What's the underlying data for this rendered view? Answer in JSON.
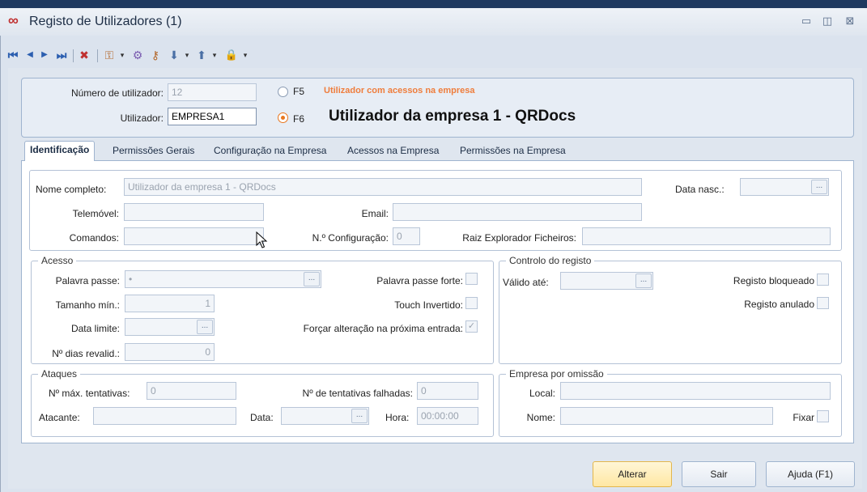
{
  "window": {
    "title": "Registo de Utilizadores (1)",
    "app_icon": "∞",
    "minimize_glyph": "▭",
    "restore_glyph": "◫",
    "close_glyph": "⊠"
  },
  "toolbar": {
    "first_glyph": "⏮",
    "prev_glyph": "◀",
    "next_glyph": "▶",
    "last_glyph": "⏭",
    "delete_glyph": "✖",
    "users_glyph": "⚿",
    "dropdown_glyph": "▾",
    "tools_glyph": "⚙",
    "key_glyph": "⚷",
    "import_glyph": "⬇",
    "export_glyph": "⬆",
    "lock_glyph": "🔒"
  },
  "header": {
    "numero_label": "Número de utilizador:",
    "numero_value": "12",
    "utilizador_label": "Utilizador:",
    "utilizador_value": "EMPRESA1",
    "f5_label": "F5",
    "f5_note": "Utilizador com acessos na empresa",
    "f6_label": "F6",
    "f6_heading": "Utilizador da empresa 1 - QRDocs",
    "f5_selected": false,
    "f6_selected": true,
    "note_color": "#ef7d3c",
    "radio_accent": "#e8761e"
  },
  "tabs": [
    {
      "label": "Identificação",
      "active": true
    },
    {
      "label": "Permissões Gerais",
      "active": false
    },
    {
      "label": "Configuração na Empresa",
      "active": false
    },
    {
      "label": "Acessos na Empresa",
      "active": false
    },
    {
      "label": "Permissões na Empresa",
      "active": false
    }
  ],
  "identificacao": {
    "nome_completo_label": "Nome completo:",
    "nome_completo_value": "Utilizador da empresa 1 - QRDocs",
    "data_nasc_label": "Data nasc.:",
    "data_nasc_value": "",
    "telemovel_label": "Telemóvel:",
    "telemovel_value": "",
    "email_label": "Email:",
    "email_value": "",
    "comandos_label": "Comandos:",
    "comandos_value": "",
    "n_config_label": "N.º Configuração:",
    "n_config_value": "0",
    "raiz_label": "Raiz Explorador Ficheiros:",
    "raiz_value": "",
    "ellipsis": "..."
  },
  "acesso": {
    "title": "Acesso",
    "palavra_passe_label": "Palavra passe:",
    "palavra_passe_value": "•",
    "palavra_passe_forte_label": "Palavra passe forte:",
    "palavra_passe_forte_checked": false,
    "tamanho_min_label": "Tamanho mín.:",
    "tamanho_min_value": "1",
    "touch_invertido_label": "Touch Invertido:",
    "touch_invertido_checked": false,
    "data_limite_label": "Data limite:",
    "data_limite_value": "",
    "forcar_label": "Forçar alteração na próxima entrada:",
    "forcar_checked": true,
    "dias_revalid_label": "Nº dias revalid.:",
    "dias_revalid_value": "0",
    "check_glyph": "✓"
  },
  "controlo": {
    "title": "Controlo do registo",
    "valido_ate_label": "Válido até:",
    "valido_ate_value": "",
    "bloqueado_label": "Registo bloqueado",
    "bloqueado_checked": false,
    "anulado_label": "Registo anulado",
    "anulado_checked": false
  },
  "ataques": {
    "title": "Ataques",
    "max_tentativas_label": "Nº máx. tentativas:",
    "max_tentativas_value": "0",
    "tentativas_falhadas_label": "Nº de tentativas falhadas:",
    "tentativas_falhadas_value": "0",
    "atacante_label": "Atacante:",
    "atacante_value": "",
    "data_label": "Data:",
    "data_value": "",
    "hora_label": "Hora:",
    "hora_value": "00:00:00"
  },
  "empresa": {
    "title": "Empresa por omissão",
    "local_label": "Local:",
    "local_value": "",
    "nome_label": "Nome:",
    "nome_value": "",
    "fixar_label": "Fixar",
    "fixar_checked": false
  },
  "buttons": {
    "alterar": "Alterar",
    "sair": "Sair",
    "ajuda": "Ajuda (F1)"
  }
}
